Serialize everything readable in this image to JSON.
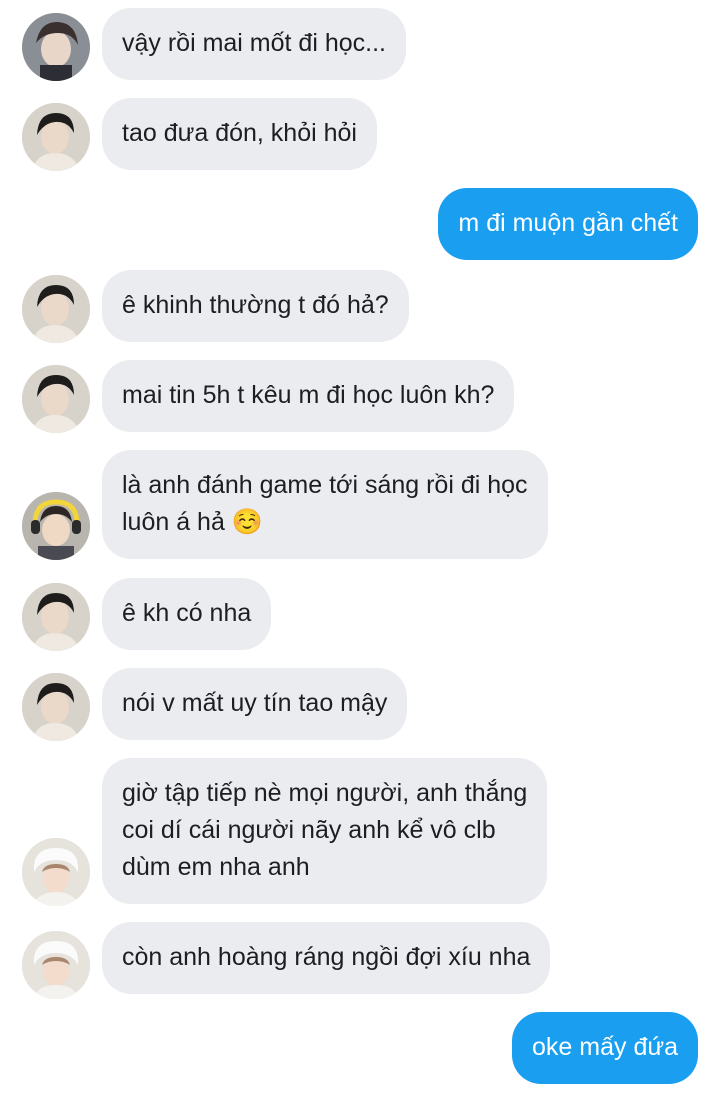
{
  "colors": {
    "incoming_bubble": "#eaecf0",
    "outgoing_bubble": "#1a9ff0",
    "incoming_text": "#1c1e21",
    "outgoing_text": "#ffffff"
  },
  "messages": [
    {
      "direction": "in",
      "avatar": "avatar-person-1",
      "text": "vậy rồi mai mốt đi học..."
    },
    {
      "direction": "in",
      "avatar": "avatar-person-2",
      "text": "tao đưa đón, khỏi hỏi"
    },
    {
      "direction": "out",
      "text": "m đi muộn gần chết"
    },
    {
      "direction": "in",
      "avatar": "avatar-person-2",
      "text": "ê khinh thường t đó hả?"
    },
    {
      "direction": "in",
      "avatar": "avatar-person-2",
      "text": "mai tin 5h t kêu m đi học luôn kh?"
    },
    {
      "direction": "in",
      "avatar": "avatar-person-3",
      "text": "là anh đánh game tới sáng rồi đi học\nluôn á hả ☺️"
    },
    {
      "direction": "in",
      "avatar": "avatar-person-2",
      "text": "ê kh có nha"
    },
    {
      "direction": "in",
      "avatar": "avatar-person-2",
      "text": "nói v mất uy tín tao mậy"
    },
    {
      "direction": "in",
      "avatar": "avatar-person-4",
      "text": "giờ tập tiếp nè mọi người, anh thắng\ncoi dí cái người nãy anh kể vô clb\ndùm em nha anh"
    },
    {
      "direction": "in",
      "avatar": "avatar-person-4",
      "text": "còn anh hoàng ráng ngồi đợi xíu nha"
    },
    {
      "direction": "out",
      "text": "oke mấy đứa"
    }
  ]
}
